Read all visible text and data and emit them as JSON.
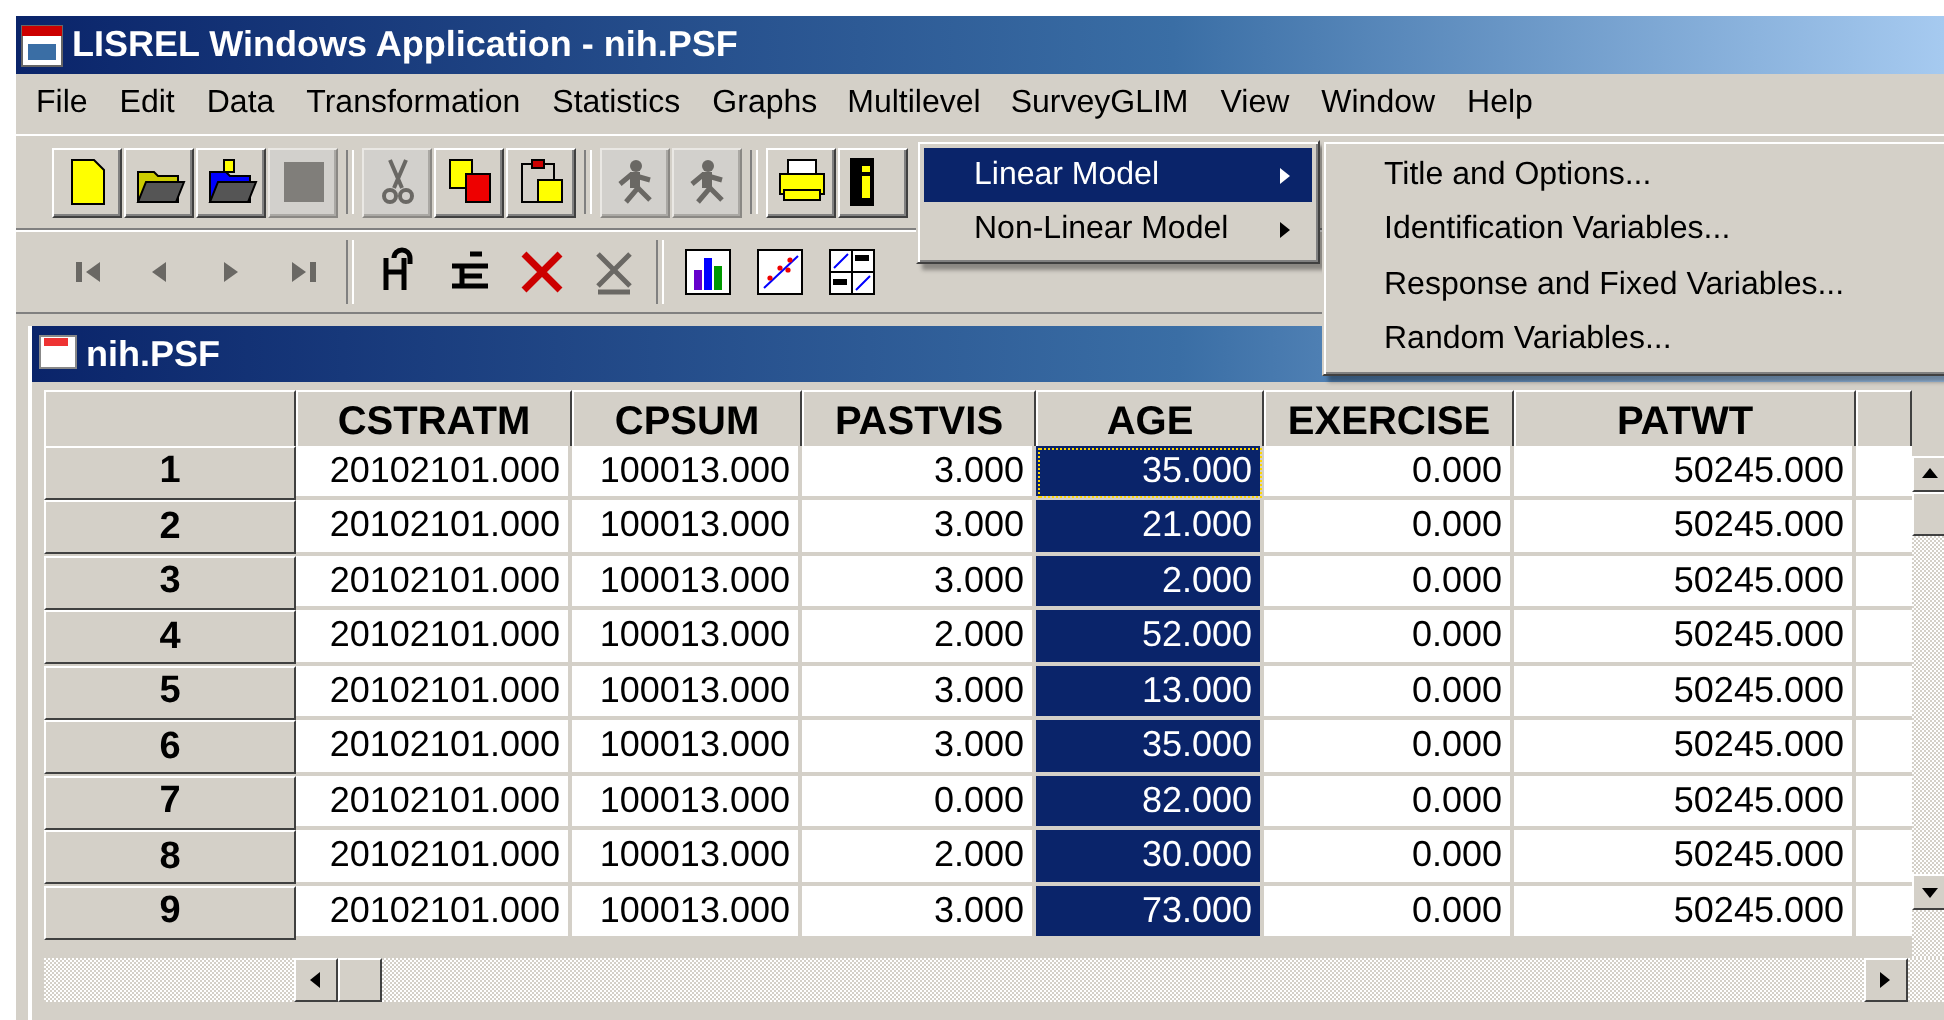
{
  "window": {
    "title": "LISREL Windows Application - nih.PSF"
  },
  "menu_bar": [
    {
      "label": "File",
      "selected": false
    },
    {
      "label": "Edit",
      "selected": false
    },
    {
      "label": "Data",
      "selected": false
    },
    {
      "label": "Transformation",
      "selected": false
    },
    {
      "label": "Statistics",
      "selected": false
    },
    {
      "label": "Graphs",
      "selected": false
    },
    {
      "label": "Multilevel",
      "selected": true
    },
    {
      "label": "SurveyGLIM",
      "selected": false
    },
    {
      "label": "View",
      "selected": false
    },
    {
      "label": "Window",
      "selected": false
    },
    {
      "label": "Help",
      "selected": false
    }
  ],
  "toolbar": [
    {
      "kind": "new",
      "disabled": false
    },
    {
      "kind": "open",
      "disabled": false
    },
    {
      "kind": "open-data",
      "disabled": false
    },
    {
      "kind": "stop",
      "disabled": true
    },
    {
      "kind": "separator"
    },
    {
      "kind": "cut",
      "disabled": true
    },
    {
      "kind": "copy",
      "disabled": false
    },
    {
      "kind": "paste",
      "disabled": false
    },
    {
      "kind": "separator"
    },
    {
      "kind": "run",
      "disabled": true
    },
    {
      "kind": "run",
      "disabled": true
    },
    {
      "kind": "separator"
    },
    {
      "kind": "print",
      "disabled": false
    },
    {
      "kind": "info",
      "disabled": false
    }
  ],
  "navigation_toolbar": [
    {
      "kind": "first",
      "disabled": true
    },
    {
      "kind": "previous",
      "disabled": true
    },
    {
      "kind": "next",
      "disabled": true
    },
    {
      "kind": "last",
      "disabled": true
    },
    {
      "kind": "separator"
    },
    {
      "kind": "insert-variable",
      "disabled": false
    },
    {
      "kind": "insert-case",
      "disabled": false
    },
    {
      "kind": "delete",
      "disabled": false
    },
    {
      "kind": "clear",
      "disabled": true
    },
    {
      "kind": "separator"
    },
    {
      "kind": "bar-chart",
      "disabled": false
    },
    {
      "kind": "scatter-plot",
      "disabled": false
    },
    {
      "kind": "matrix-plot",
      "disabled": false
    }
  ],
  "document": {
    "title": "nih.PSF"
  },
  "table": {
    "columns": [
      {
        "label": "CSTRATM",
        "selected": false
      },
      {
        "label": "CPSUM",
        "selected": false
      },
      {
        "label": "PASTVIS",
        "selected": false
      },
      {
        "label": "AGE",
        "selected": true
      },
      {
        "label": "EXERCISE",
        "selected": false
      },
      {
        "label": "PATWT",
        "selected": false
      }
    ],
    "rows": [
      {
        "header": "1",
        "cells": [
          "20102101.000",
          "100013.000",
          "3.000",
          "35.000",
          "0.000",
          "50245.000"
        ]
      },
      {
        "header": "2",
        "cells": [
          "20102101.000",
          "100013.000",
          "3.000",
          "21.000",
          "0.000",
          "50245.000"
        ]
      },
      {
        "header": "3",
        "cells": [
          "20102101.000",
          "100013.000",
          "3.000",
          "2.000",
          "0.000",
          "50245.000"
        ]
      },
      {
        "header": "4",
        "cells": [
          "20102101.000",
          "100013.000",
          "2.000",
          "52.000",
          "0.000",
          "50245.000"
        ]
      },
      {
        "header": "5",
        "cells": [
          "20102101.000",
          "100013.000",
          "3.000",
          "13.000",
          "0.000",
          "50245.000"
        ]
      },
      {
        "header": "6",
        "cells": [
          "20102101.000",
          "100013.000",
          "3.000",
          "35.000",
          "0.000",
          "50245.000"
        ]
      },
      {
        "header": "7",
        "cells": [
          "20102101.000",
          "100013.000",
          "0.000",
          "82.000",
          "0.000",
          "50245.000"
        ]
      },
      {
        "header": "8",
        "cells": [
          "20102101.000",
          "100013.000",
          "2.000",
          "30.000",
          "0.000",
          "50245.000"
        ]
      },
      {
        "header": "9",
        "cells": [
          "20102101.000",
          "100013.000",
          "3.000",
          "73.000",
          "0.000",
          "50245.000"
        ]
      }
    ]
  },
  "menu": {
    "items": [
      {
        "label": "Linear Model",
        "selected": true
      },
      {
        "label": "Non-Linear Model",
        "selected": false
      }
    ]
  },
  "submenu": {
    "items": [
      "Title and Options...",
      "Identification Variables...",
      "Response and Fixed Variables...",
      "Random Variables..."
    ]
  }
}
